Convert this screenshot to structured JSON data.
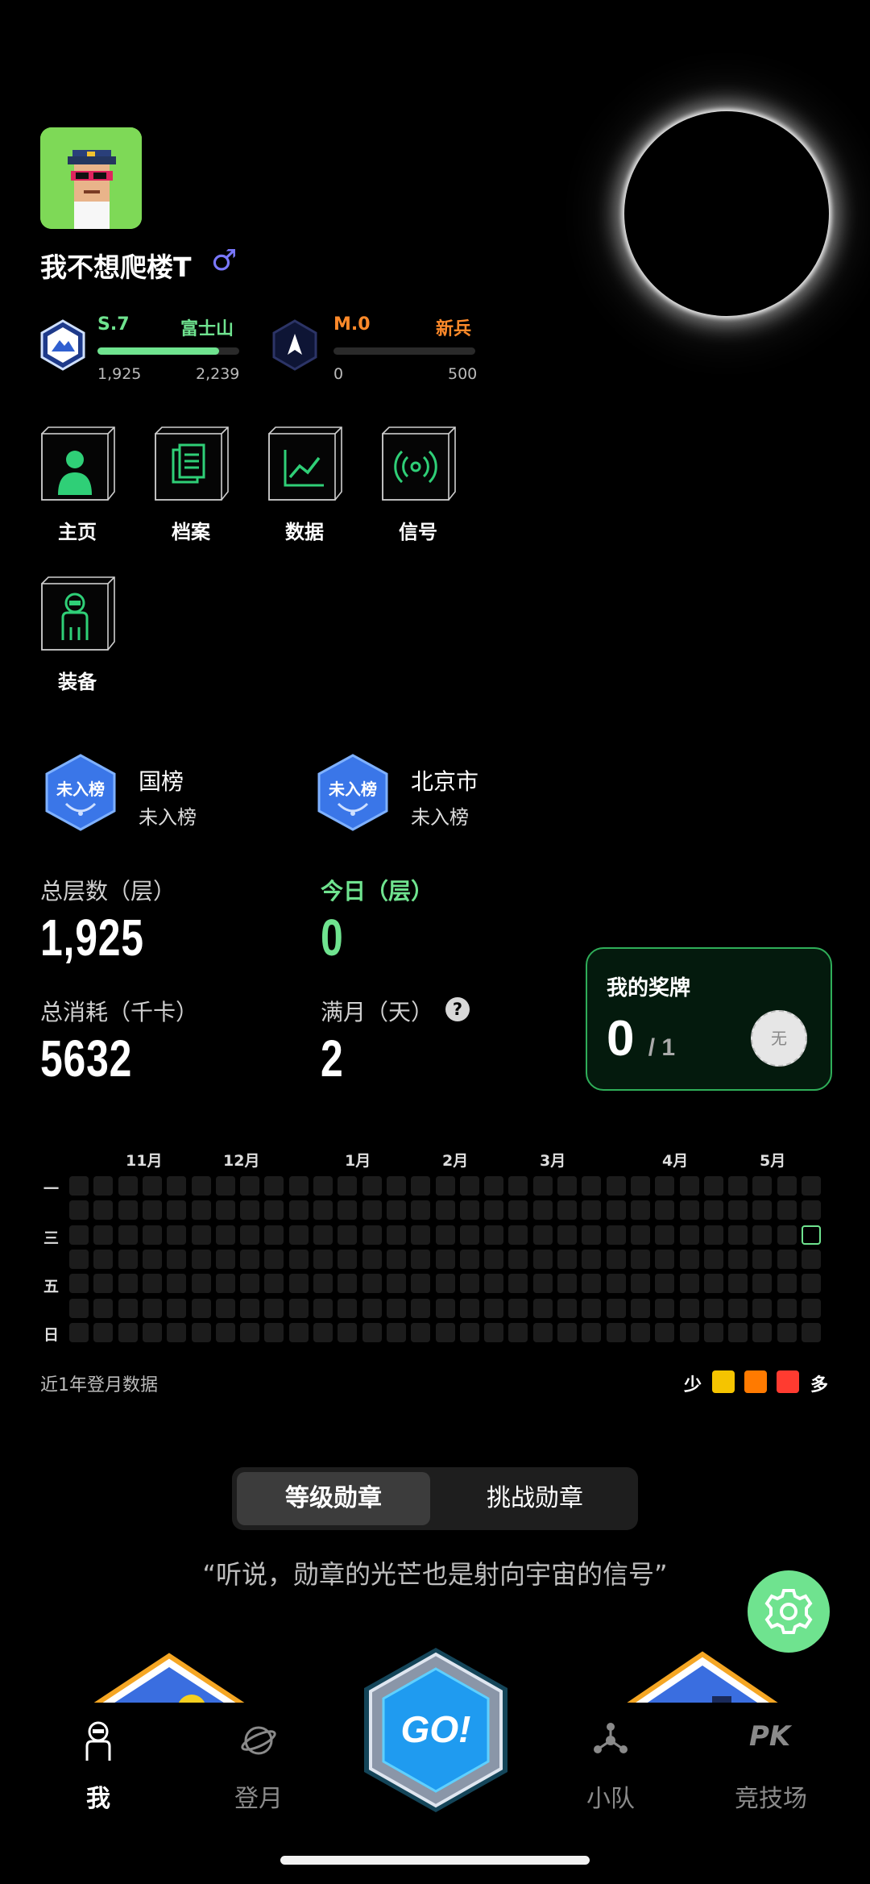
{
  "profile": {
    "username": "我不想爬楼T",
    "gender_icon": "♂"
  },
  "ranks": [
    {
      "code": "S.7",
      "title": "富士山",
      "current": "1,925",
      "target": "2,239",
      "progress": 0.86,
      "title_color": "#6fe38f",
      "code_color": "#6fe38f"
    },
    {
      "code": "M.0",
      "title": "新兵",
      "current": "0",
      "target": "500",
      "progress": 0.0,
      "title_color": "#ff8a2a",
      "code_color": "#ff8a2a"
    }
  ],
  "menu": {
    "items": [
      {
        "label": "主页",
        "icon": "person-icon"
      },
      {
        "label": "档案",
        "icon": "document-icon"
      },
      {
        "label": "数据",
        "icon": "chart-icon"
      },
      {
        "label": "信号",
        "icon": "signal-icon"
      },
      {
        "label": "装备",
        "icon": "gear-suit-icon"
      }
    ]
  },
  "leaderboards": [
    {
      "badge_text": "未入榜",
      "title": "国榜",
      "status": "未入榜"
    },
    {
      "badge_text": "未入榜",
      "title": "北京市",
      "status": "未入榜"
    }
  ],
  "stats": {
    "total_floors_label": "总层数（层）",
    "total_floors_value": "1,925",
    "today_label": "今日（层）",
    "today_value": "0",
    "calories_label": "总消耗（千卡）",
    "calories_value": "5632",
    "full_month_label": "满月（天）",
    "full_month_value": "2",
    "help_icon": "?"
  },
  "medals": {
    "title": "我的奖牌",
    "count": "0",
    "total": "/ 1",
    "coin_text": "无"
  },
  "calendar": {
    "months": [
      "11月",
      "12月",
      "1月",
      "2月",
      "3月",
      "4月",
      "5月"
    ],
    "day_labels": [
      "一",
      "三",
      "五",
      "日"
    ],
    "caption": "近1年登月数据",
    "legend_less": "少",
    "legend_more": "多",
    "legend_colors": [
      "#f5c400",
      "#ff7a00",
      "#ff3b30"
    ]
  },
  "tabs": {
    "active": "等级勋章",
    "inactive": "挑战勋章"
  },
  "quote": "“听说，勋章的光芒也是射向宇宙的信号”",
  "nav": {
    "items": [
      {
        "label": "我",
        "active": true
      },
      {
        "label": "登月",
        "active": false
      },
      {
        "label": "小队",
        "active": false
      },
      {
        "label": "竞技场",
        "active": false
      }
    ],
    "go_label": "GO!",
    "pk_text": "PK"
  }
}
